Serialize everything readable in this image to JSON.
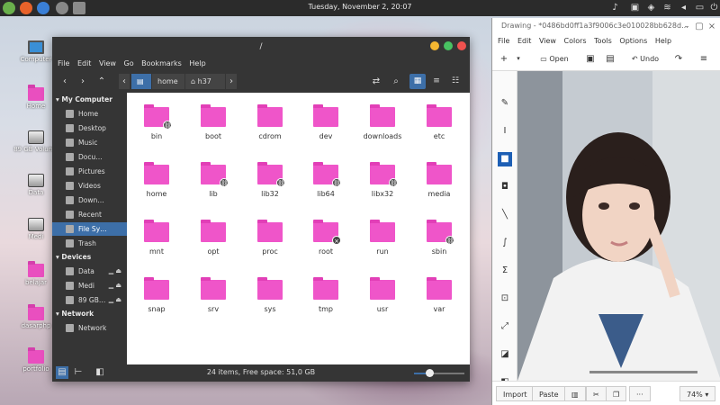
{
  "panel": {
    "clock": "Tuesday, November  2, 20:07"
  },
  "desktop": {
    "icons": [
      "Computer",
      "Home",
      "89 GB Volume",
      "Data",
      "Medi",
      "belajar",
      "dasarphp",
      "portfolio"
    ]
  },
  "file_manager": {
    "title": "/",
    "menu": [
      "File",
      "Edit",
      "View",
      "Go",
      "Bookmarks",
      "Help"
    ],
    "path": [
      "home",
      "h37"
    ],
    "sidebar": {
      "sections": [
        {
          "title": "My Computer",
          "items": [
            "Home",
            "Desktop",
            "Music",
            "Docu…",
            "Pictures",
            "Videos",
            "Down…",
            "Recent",
            "File Sy…",
            "Trash"
          ]
        },
        {
          "title": "Devices",
          "items": [
            "Data",
            "Medi",
            "89 GB…"
          ]
        },
        {
          "title": "Network",
          "items": [
            "Network"
          ]
        }
      ],
      "selected": "File Sy…"
    },
    "folders": [
      {
        "name": "bin",
        "badge": "link"
      },
      {
        "name": "boot",
        "badge": ""
      },
      {
        "name": "cdrom",
        "badge": ""
      },
      {
        "name": "dev",
        "badge": ""
      },
      {
        "name": "downloads",
        "badge": ""
      },
      {
        "name": "etc",
        "badge": ""
      },
      {
        "name": "home",
        "badge": ""
      },
      {
        "name": "lib",
        "badge": "link"
      },
      {
        "name": "lib32",
        "badge": "link"
      },
      {
        "name": "lib64",
        "badge": "link"
      },
      {
        "name": "libx32",
        "badge": "link"
      },
      {
        "name": "media",
        "badge": ""
      },
      {
        "name": "mnt",
        "badge": ""
      },
      {
        "name": "opt",
        "badge": ""
      },
      {
        "name": "proc",
        "badge": ""
      },
      {
        "name": "root",
        "badge": "locked"
      },
      {
        "name": "run",
        "badge": ""
      },
      {
        "name": "sbin",
        "badge": "link"
      },
      {
        "name": "snap",
        "badge": ""
      },
      {
        "name": "srv",
        "badge": ""
      },
      {
        "name": "sys",
        "badge": ""
      },
      {
        "name": "tmp",
        "badge": ""
      },
      {
        "name": "usr",
        "badge": ""
      },
      {
        "name": "var",
        "badge": ""
      }
    ],
    "status": "24 items, Free space: 51,0 GB",
    "zoom_level": 0.3
  },
  "drawing": {
    "title": "Drawing - *0486bd0ff1a3f9006c3e010028bb628d...",
    "menu": [
      "File",
      "Edit",
      "View",
      "Colors",
      "Tools",
      "Options",
      "Help"
    ],
    "toolbar": {
      "open": "Open",
      "undo": "Undo"
    },
    "bottom": {
      "import": "Import",
      "paste": "Paste",
      "more": "···",
      "zoom": "74%"
    }
  },
  "colors": {
    "accent": "#3d6fa8",
    "folder": "#ef55c9",
    "panel": "#2b2b2b",
    "window_dark": "#353535"
  }
}
